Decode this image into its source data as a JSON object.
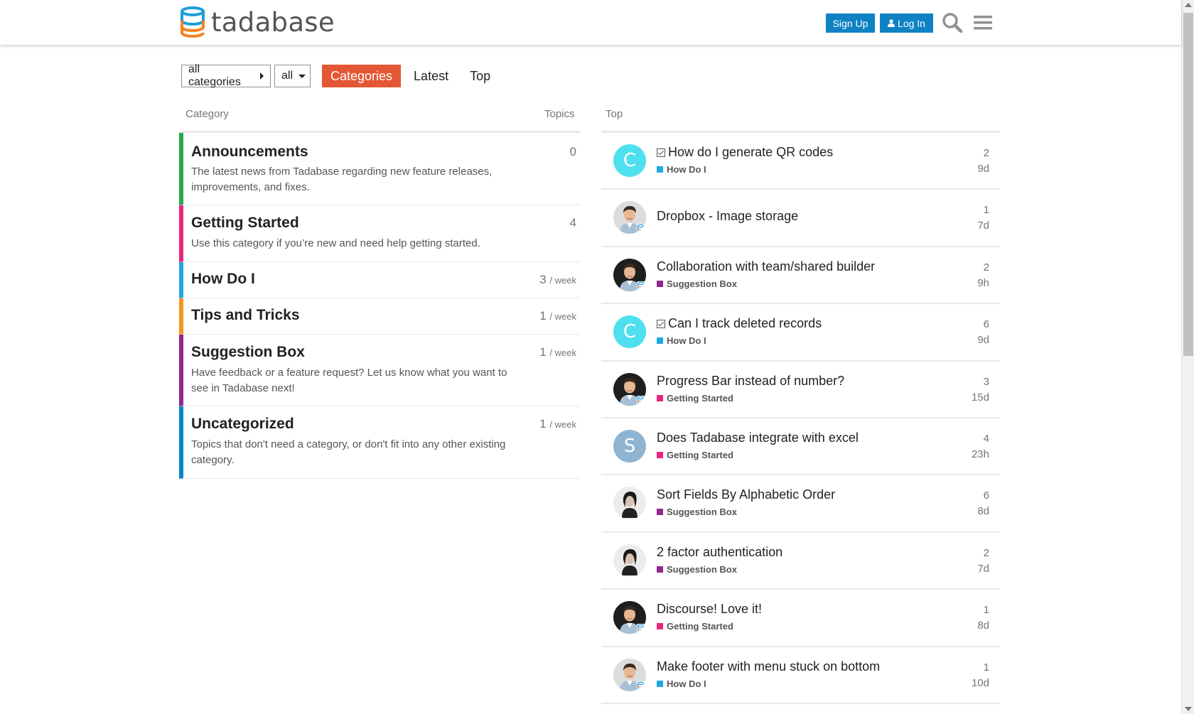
{
  "header": {
    "logo_text": "tadabase",
    "signup_label": "Sign Up",
    "login_label": "Log In"
  },
  "nav": {
    "category_dropdown": "all categories",
    "filter_dropdown": "all",
    "tabs": [
      "Categories",
      "Latest",
      "Top"
    ]
  },
  "categories": {
    "col_category": "Category",
    "col_topics": "Topics",
    "items": [
      {
        "name": "Announcements",
        "desc": "The latest news from Tadabase regarding new feature releases, improvements, and fixes.",
        "topics": "0",
        "unit": "",
        "color": "#25aa4a"
      },
      {
        "name": "Getting Started",
        "desc": "Use this category if you’re new and need help getting started.",
        "topics": "4",
        "unit": "",
        "color": "#e9257d"
      },
      {
        "name": "How Do I",
        "desc": "",
        "topics": "3",
        "unit": "/ week",
        "color": "#20a9e0"
      },
      {
        "name": "Tips and Tricks",
        "desc": "",
        "topics": "1",
        "unit": "/ week",
        "color": "#f7941d"
      },
      {
        "name": "Suggestion Box",
        "desc": "Have feedback or a feature request? Let us know what you want to see in Tadabase next!",
        "topics": "1",
        "unit": "/ week",
        "color": "#92278f"
      },
      {
        "name": "Uncategorized",
        "desc": "Topics that don't need a category, or don't fit into any other existing category.",
        "topics": "1",
        "unit": "/ week",
        "color": "#0088cc"
      }
    ]
  },
  "top": {
    "heading": "Top",
    "topics": [
      {
        "title": "How do I generate QR codes",
        "solved": true,
        "category": "How Do I",
        "cat_color": "#20a9e0",
        "posts": "2",
        "age": "9d",
        "avatar": "letter",
        "letter": "C",
        "avatar_color": "#4fe0f0"
      },
      {
        "title": "Dropbox - Image storage",
        "solved": false,
        "category": "",
        "cat_color": "",
        "posts": "1",
        "age": "7d",
        "avatar": "photo-light",
        "letter": "",
        "avatar_color": ""
      },
      {
        "title": "Collaboration with team/shared builder",
        "solved": false,
        "category": "Suggestion Box",
        "cat_color": "#92278f",
        "posts": "2",
        "age": "9h",
        "avatar": "photo-dark",
        "letter": "",
        "avatar_color": ""
      },
      {
        "title": "Can I track deleted records",
        "solved": true,
        "category": "How Do I",
        "cat_color": "#20a9e0",
        "posts": "6",
        "age": "9d",
        "avatar": "letter",
        "letter": "C",
        "avatar_color": "#4fe0f0"
      },
      {
        "title": "Progress Bar instead of number?",
        "solved": false,
        "category": "Getting Started",
        "cat_color": "#e9257d",
        "posts": "3",
        "age": "15d",
        "avatar": "photo-dark",
        "letter": "",
        "avatar_color": ""
      },
      {
        "title": "Does Tadabase integrate with excel",
        "solved": false,
        "category": "Getting Started",
        "cat_color": "#e9257d",
        "posts": "4",
        "age": "23h",
        "avatar": "letter",
        "letter": "S",
        "avatar_color": "#8fb4d1"
      },
      {
        "title": "Sort Fields By Alphabetic Order",
        "solved": false,
        "category": "Suggestion Box",
        "cat_color": "#92278f",
        "posts": "6",
        "age": "8d",
        "avatar": "photo-woman",
        "letter": "",
        "avatar_color": ""
      },
      {
        "title": "2 factor authentication",
        "solved": false,
        "category": "Suggestion Box",
        "cat_color": "#92278f",
        "posts": "2",
        "age": "7d",
        "avatar": "photo-woman",
        "letter": "",
        "avatar_color": ""
      },
      {
        "title": "Discourse! Love it!",
        "solved": false,
        "category": "Getting Started",
        "cat_color": "#e9257d",
        "posts": "1",
        "age": "8d",
        "avatar": "photo-dark",
        "letter": "",
        "avatar_color": ""
      },
      {
        "title": "Make footer with menu stuck on bottom",
        "solved": false,
        "category": "How Do I",
        "cat_color": "#20a9e0",
        "posts": "1",
        "age": "10d",
        "avatar": "photo-light",
        "letter": "",
        "avatar_color": ""
      }
    ]
  }
}
